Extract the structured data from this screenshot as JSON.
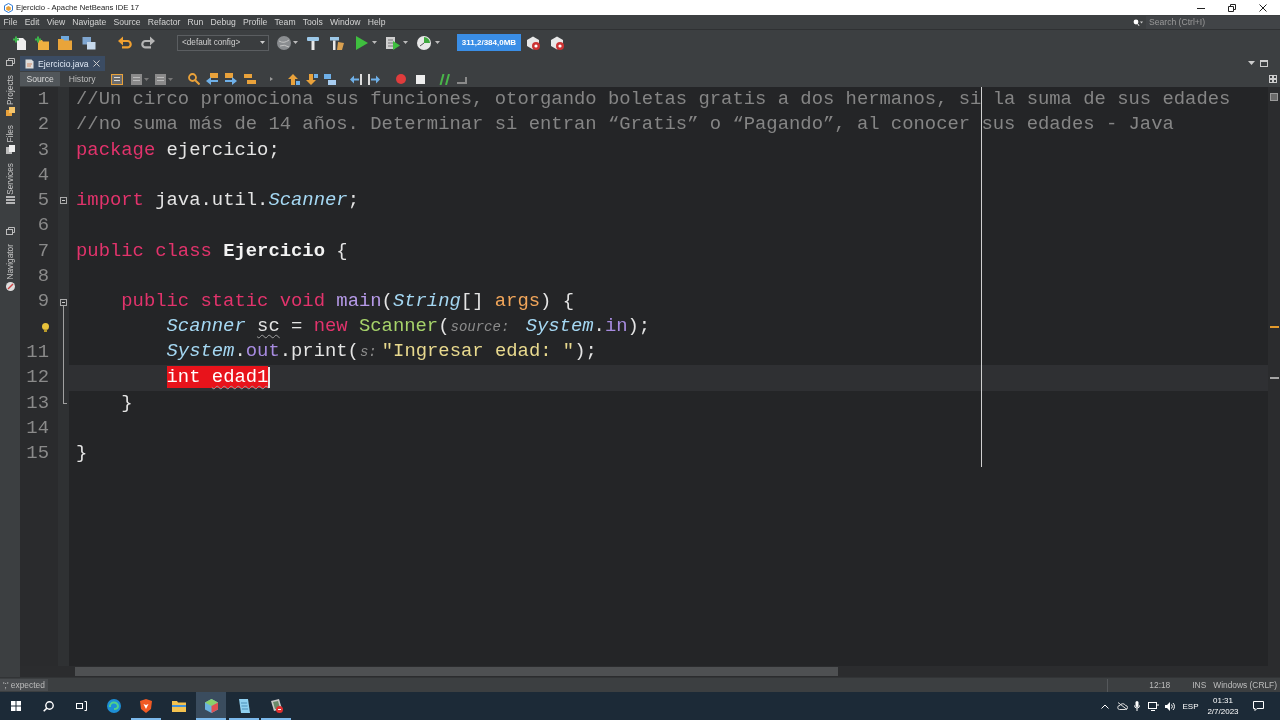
{
  "window": {
    "title": "Ejercicio - Apache NetBeans IDE 17"
  },
  "menu": [
    "File",
    "Edit",
    "View",
    "Navigate",
    "Source",
    "Refactor",
    "Run",
    "Debug",
    "Profile",
    "Team",
    "Tools",
    "Window",
    "Help"
  ],
  "search": {
    "placeholder": "Search (Ctrl+I)"
  },
  "toolbar": {
    "config": "<default config>",
    "memory": "311,2/384,0MB"
  },
  "side_panels": [
    {
      "items": [
        {
          "label": "Projects",
          "kind": "projects"
        },
        {
          "label": "Files",
          "kind": "files"
        },
        {
          "label": "Services",
          "kind": "services"
        }
      ]
    },
    {
      "items": [
        {
          "label": "Navigator",
          "kind": "navigator"
        }
      ]
    }
  ],
  "tabs": [
    {
      "label": "Ejercicio.java",
      "selected": true
    }
  ],
  "editor_views": [
    {
      "label": "Source",
      "selected": true
    },
    {
      "label": "History",
      "selected": false
    }
  ],
  "editor": {
    "lines": [
      {
        "number": "1",
        "hint": false,
        "fold_start": false,
        "fold_end": false,
        "current": false,
        "tokens": [
          {
            "text": "//Un circo promociona sus funciones, otorgando boletas gratis a dos hermanos, si la suma de sus edades",
            "kind": "comment"
          }
        ]
      },
      {
        "number": "2",
        "hint": false,
        "fold_start": false,
        "fold_end": false,
        "current": false,
        "tokens": [
          {
            "text": "//no suma más de 14 años. Determinar si entran “Gratis” o “Pagando”, al conocer sus edades - Java",
            "kind": "comment"
          }
        ]
      },
      {
        "number": "3",
        "hint": false,
        "fold_start": false,
        "fold_end": false,
        "current": false,
        "tokens": [
          {
            "text": "package",
            "kind": "keyword"
          },
          {
            "text": " ejercicio;",
            "kind": "plain"
          }
        ]
      },
      {
        "number": "4",
        "hint": false,
        "fold_start": false,
        "fold_end": false,
        "current": false
      },
      {
        "number": "5",
        "hint": false,
        "fold_start": true,
        "fold_end": false,
        "current": false,
        "tokens": [
          {
            "text": "import",
            "kind": "keyword"
          },
          {
            "text": " java.util.",
            "kind": "plain"
          },
          {
            "text": "Scanner",
            "kind": "type"
          },
          {
            "text": ";",
            "kind": "plain"
          }
        ]
      },
      {
        "number": "6",
        "hint": false,
        "fold_start": false,
        "fold_end": false,
        "current": false
      },
      {
        "number": "7",
        "hint": false,
        "fold_start": false,
        "fold_end": false,
        "current": false,
        "tokens": [
          {
            "text": "public class ",
            "kind": "keyword"
          },
          {
            "text": "Ejercicio",
            "kind": "class-name"
          },
          {
            "text": " {",
            "kind": "plain"
          }
        ]
      },
      {
        "number": "8",
        "hint": false,
        "fold_start": false,
        "fold_end": false,
        "current": false
      },
      {
        "number": "9",
        "hint": false,
        "fold_start": true,
        "fold_end": false,
        "current": false,
        "tokens": [
          {
            "text": "    public static void ",
            "kind": "keyword"
          },
          {
            "text": "main",
            "kind": "method"
          },
          {
            "text": "(",
            "kind": "plain"
          },
          {
            "text": "String",
            "kind": "type"
          },
          {
            "text": "[] ",
            "kind": "plain"
          },
          {
            "text": "args",
            "kind": "param"
          },
          {
            "text": ") {",
            "kind": "plain"
          }
        ]
      },
      {
        "hint": true,
        "fold_start": false,
        "fold_end": false,
        "current": false,
        "tokens": [
          {
            "text": "        Scanner ",
            "kind": "type"
          },
          {
            "text": "sc",
            "kind": "unused"
          },
          {
            "text": " = ",
            "kind": "plain"
          },
          {
            "text": "new ",
            "kind": "keyword"
          },
          {
            "text": "Scanner",
            "kind": "constructor"
          },
          {
            "text": "(",
            "kind": "plain"
          },
          {
            "text": "source:",
            "kind": "hint"
          },
          {
            "text": " System",
            "kind": "type"
          },
          {
            "text": ".",
            "kind": "plain"
          },
          {
            "text": "in",
            "kind": "field"
          },
          {
            "text": ");",
            "kind": "plain"
          }
        ]
      },
      {
        "number": "11",
        "hint": false,
        "fold_start": false,
        "fold_end": false,
        "current": false,
        "tokens": [
          {
            "text": "        System",
            "kind": "type"
          },
          {
            "text": ".",
            "kind": "plain"
          },
          {
            "text": "out",
            "kind": "field"
          },
          {
            "text": ".print(",
            "kind": "plain"
          },
          {
            "text": "s:",
            "kind": "hint"
          },
          {
            "text": "\"Ingresar edad: \"",
            "kind": "string"
          },
          {
            "text": ");",
            "kind": "plain"
          }
        ]
      },
      {
        "number": "12",
        "hint": false,
        "fold_start": false,
        "fold_end": false,
        "current": true,
        "tokens": [
          {
            "text": "        int ",
            "kind": "error"
          },
          {
            "text": "edad1",
            "kind": "error-unused"
          }
        ]
      },
      {
        "number": "13",
        "hint": false,
        "fold_start": false,
        "fold_end": true,
        "current": false,
        "tokens": [
          {
            "text": "    }",
            "kind": "plain"
          }
        ]
      },
      {
        "number": "14",
        "hint": false,
        "fold_start": false,
        "fold_end": false,
        "current": false
      },
      {
        "number": "15",
        "hint": false,
        "fold_start": false,
        "fold_end": false,
        "current": false,
        "tokens": [
          {
            "text": "}",
            "kind": "plain"
          }
        ]
      }
    ]
  },
  "status_bar": {
    "message": "';' expected",
    "position": "12:18",
    "mode": "INS",
    "line_endings": "Windows (CRLF)"
  },
  "taskbar": {
    "apps": [
      {
        "kind": "swirl",
        "running": false,
        "selected": false
      },
      {
        "kind": "shield",
        "running": true,
        "selected": false
      },
      {
        "kind": "folder",
        "running": false,
        "selected": false
      },
      {
        "kind": "cube",
        "running": true,
        "selected": true
      },
      {
        "kind": "notepad",
        "running": true,
        "selected": false
      },
      {
        "kind": "tablet",
        "running": true,
        "selected": false
      }
    ],
    "language": "ESP",
    "time": "01:31",
    "date": "2/7/2023"
  }
}
